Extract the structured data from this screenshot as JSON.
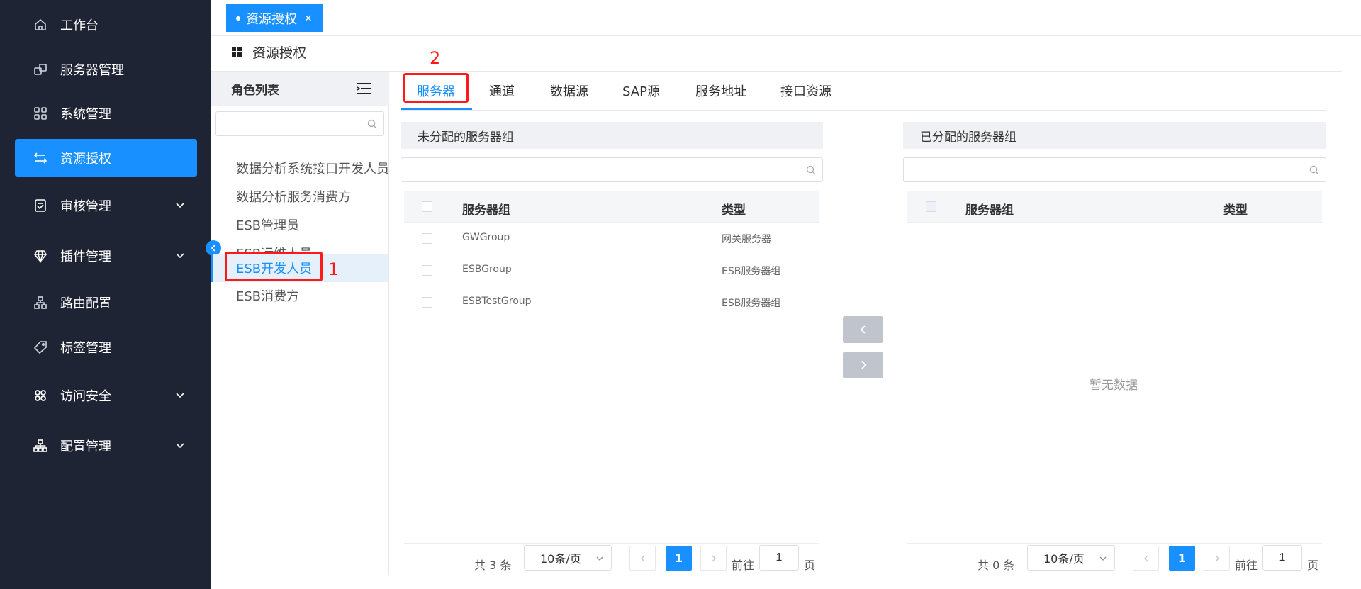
{
  "sidebar": {
    "items": [
      {
        "label": "工作台",
        "icon": "home-icon"
      },
      {
        "label": "服务器管理",
        "icon": "server-icon"
      },
      {
        "label": "系统管理",
        "icon": "grid-icon"
      },
      {
        "label": "资源授权",
        "icon": "exchange-icon",
        "active": true
      },
      {
        "label": "审核管理",
        "icon": "audit-icon",
        "expandable": true
      },
      {
        "label": "插件管理",
        "icon": "diamond-icon",
        "expandable": true
      },
      {
        "label": "路由配置",
        "icon": "route-icon"
      },
      {
        "label": "标签管理",
        "icon": "tag-icon"
      },
      {
        "label": "访问安全",
        "icon": "security-icon",
        "expandable": true
      },
      {
        "label": "配置管理",
        "icon": "config-icon",
        "expandable": true
      }
    ]
  },
  "tabbar": {
    "active_tab": "资源授权",
    "close": "×"
  },
  "breadcrumb": {
    "title": "资源授权"
  },
  "roles": {
    "title": "角色列表",
    "search_placeholder": "",
    "items": [
      "数据分析系统接口开发人员",
      "数据分析服务消费方",
      "ESB管理员",
      "ESB运维人员",
      "ESB开发人员",
      "ESB消费方"
    ],
    "selected": "ESB开发人员"
  },
  "resource_tabs": [
    "服务器",
    "通道",
    "数据源",
    "SAP源",
    "服务地址",
    "接口资源"
  ],
  "annotations": {
    "one": "1",
    "two": "2"
  },
  "unassigned": {
    "title": "未分配的服务器组",
    "columns": [
      "服务器组",
      "类型"
    ],
    "rows": [
      {
        "group": "GWGroup",
        "type": "网关服务器"
      },
      {
        "group": "ESBGroup",
        "type": "ESB服务器组"
      },
      {
        "group": "ESBTestGroup",
        "type": "ESB服务器组"
      }
    ],
    "pager": {
      "total": "共 3 条",
      "size": "10条/页",
      "current": "1",
      "goto": "前往",
      "goto_value": "1",
      "page": "页"
    }
  },
  "assigned": {
    "title": "已分配的服务器组",
    "columns": [
      "服务器组",
      "类型"
    ],
    "empty": "暂无数据",
    "pager": {
      "total": "共 0 条",
      "size": "10条/页",
      "current": "1",
      "goto": "前往",
      "goto_value": "1",
      "page": "页"
    }
  },
  "colors": {
    "primary": "#1890ff",
    "sidebar_bg": "#1f2435",
    "annotation": "#ff1a1a"
  }
}
